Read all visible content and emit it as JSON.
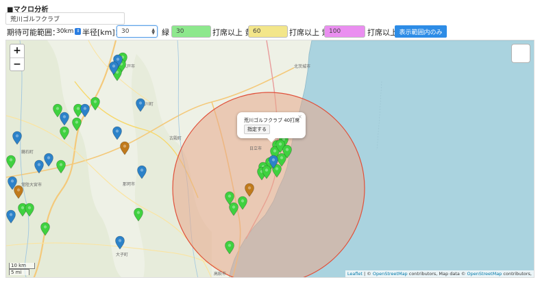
{
  "header": {
    "section_title": "■マクロ分析",
    "course_name": "荒川ゴルフクラブ"
  },
  "controls": {
    "range_label": "期待可能範囲：",
    "range_value": "30km",
    "radius_label": "半径[km]：",
    "radius_value": "30",
    "green_label": "緑",
    "green_value": "30",
    "yellow_prefix": "打席以上 黄",
    "yellow_value": "60",
    "purple_prefix": "打席以上 紫",
    "purple_value": "100",
    "tail_label": "打席以上",
    "show_button": "表示範囲内のみ"
  },
  "map": {
    "zoom_in": "+",
    "zoom_out": "−",
    "popup": {
      "title": "荒川ゴルフクラブ 40打席",
      "button": "指定する",
      "close": "×"
    },
    "scale": {
      "km": "10 km",
      "mi": "5 mi"
    },
    "attribution": {
      "leaflet": "Leaflet",
      "sep1": " | © ",
      "osm1": "OpenStreetMap",
      "mid": " contributors, Map data © ",
      "osm2": "OpenStreetMap",
      "tail": " contributors,"
    },
    "place_labels": [
      {
        "text": "北茨城市"
      },
      {
        "text": "日立市"
      },
      {
        "text": "大子町"
      },
      {
        "text": "常陸大宮市"
      },
      {
        "text": "那珂市"
      },
      {
        "text": "水戸市"
      },
      {
        "text": "高萩市"
      },
      {
        "text": "古殿町"
      },
      {
        "text": "鏡石町"
      },
      {
        "text": "石川町"
      }
    ],
    "colors": {
      "sea": "#aad3df",
      "land": "#eef1e6",
      "circle_fill": "#e8a88a",
      "circle_stroke": "#e0503a",
      "pin_green": "#3fd13f",
      "pin_blue": "#2c82c9",
      "pin_orange": "#c07a1c"
    },
    "pins_green": 29,
    "pins_blue": 18,
    "pins_orange": 3
  }
}
